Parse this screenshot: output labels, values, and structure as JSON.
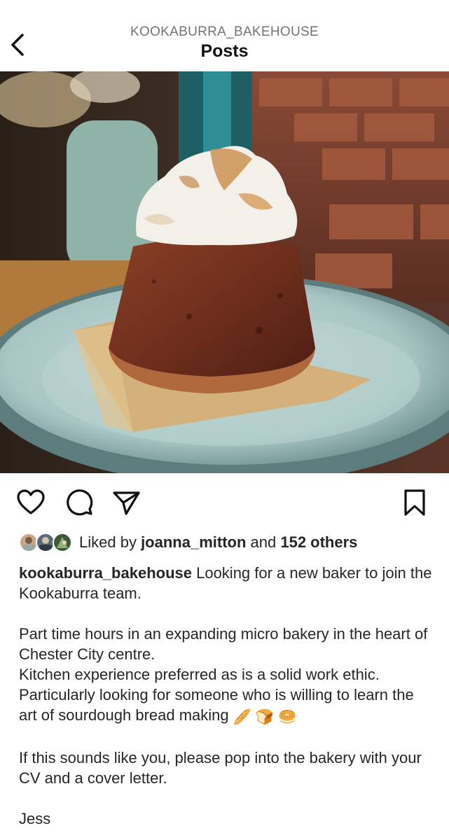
{
  "header": {
    "username": "KOOKABURRA_BAKEHOUSE",
    "title": "Posts",
    "back_icon": "chevron-left-icon"
  },
  "post": {
    "image_icon": "photo-chocolate-cake-meringue",
    "actions": {
      "like_icon": "heart-icon",
      "comment_icon": "comment-icon",
      "share_icon": "paper-plane-icon",
      "save_icon": "bookmark-icon"
    },
    "likes": {
      "prefix": "Liked by ",
      "user": "joanna_mitton",
      "middle": " and ",
      "others": "152 others"
    },
    "caption": {
      "username": "kookaburra_bakehouse",
      "line1": " Looking for a new baker to join the Kookaburra team.",
      "para2_line1": "Part time hours in an expanding micro bakery in the heart of Chester City centre.",
      "para2_line2": "Kitchen experience preferred as is a solid work ethic.",
      "para2_line3": "Particularly looking for someone who is willing to learn the art of sourdough bread making",
      "emojis": [
        "🥖",
        "🍞",
        "🥯"
      ],
      "para3": "If this sounds like you, please pop into the bakery with your CV and a cover letter.",
      "signoff": "Jess"
    }
  }
}
